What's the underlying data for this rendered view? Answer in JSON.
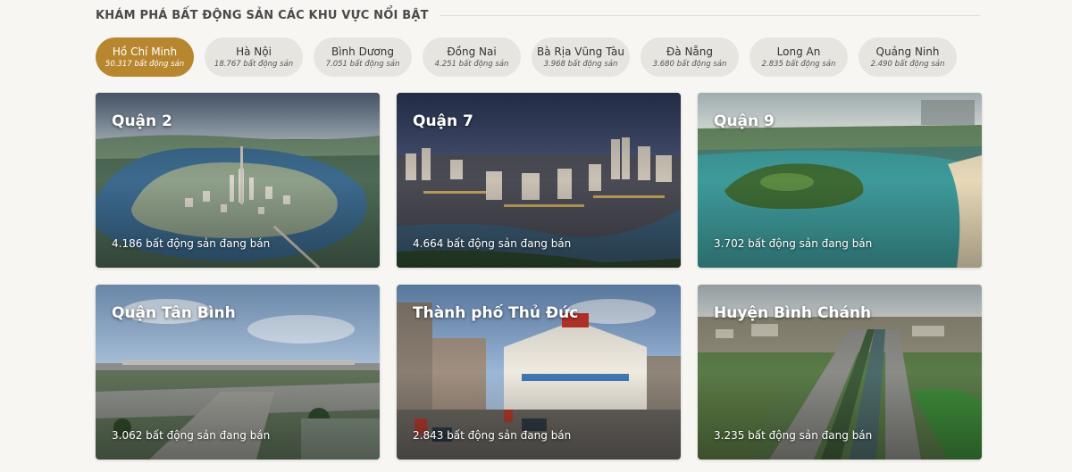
{
  "section": {
    "title": "KHÁM PHÁ BẤT ĐỘNG SẢN CÁC KHU VỰC NỔI BẬT"
  },
  "tabs": [
    {
      "name": "Hồ Chí Minh",
      "count": "50.317 bất động sản",
      "active": true
    },
    {
      "name": "Hà Nội",
      "count": "18.767 bất động sản",
      "active": false
    },
    {
      "name": "Bình Dương",
      "count": "7.051 bất động sản",
      "active": false
    },
    {
      "name": "Đồng Nai",
      "count": "4.251 bất động sản",
      "active": false
    },
    {
      "name": "Bà Rịa Vũng Tàu",
      "count": "3.968 bất động sản",
      "active": false
    },
    {
      "name": "Đà Nẵng",
      "count": "3.680 bất động sản",
      "active": false
    },
    {
      "name": "Long An",
      "count": "2.835 bất động sản",
      "active": false
    },
    {
      "name": "Quảng Ninh",
      "count": "2.490 bất động sản",
      "active": false
    }
  ],
  "cards": [
    {
      "title": "Quận 2",
      "count": "4.186 bất động sản đang bán",
      "image": "aerial-river-bend-peninsula"
    },
    {
      "title": "Quận 7",
      "count": "4.664 bất động sản đang bán",
      "image": "city-skyline-river-dusk"
    },
    {
      "title": "Quận 9",
      "count": "3.702 bất động sản đang bán",
      "image": "lagoon-island-park"
    },
    {
      "title": "Quận Tân Bình",
      "count": "3.062 bất động sản đang bán",
      "image": "airport-terminal"
    },
    {
      "title": "Thành phố Thủ Đức",
      "count": "2.843 bất động sản đang bán",
      "image": "market-building-street"
    },
    {
      "title": "Huyện Bình Chánh",
      "count": "3.235 bất động sản đang bán",
      "image": "highway-canal-aerial"
    }
  ],
  "colors": {
    "accent": "#b8862e",
    "tab_bg": "#e7e5e0",
    "page_bg": "#f7f6f3"
  }
}
